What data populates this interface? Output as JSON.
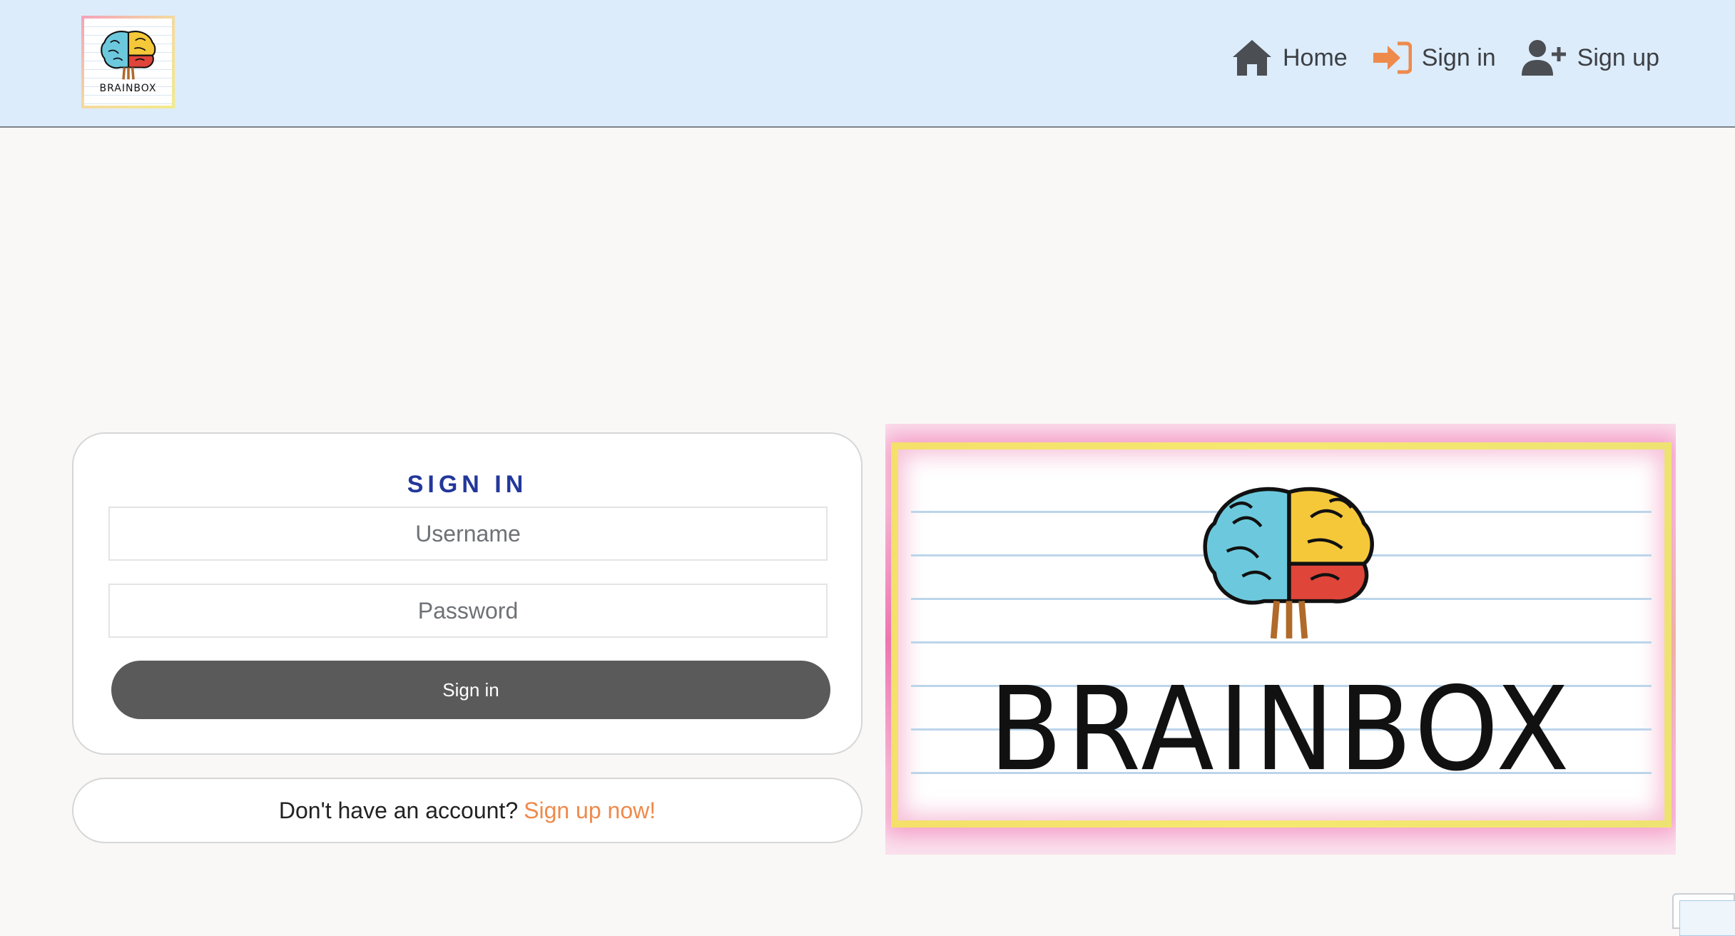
{
  "header": {
    "logo_text": "BRAINBOX",
    "nav": [
      {
        "label": "Home",
        "icon": "home-icon"
      },
      {
        "label": "Sign in",
        "icon": "sign-in-icon"
      },
      {
        "label": "Sign up",
        "icon": "user-plus-icon"
      }
    ]
  },
  "signin": {
    "title": "SIGN IN",
    "username_placeholder": "Username",
    "password_placeholder": "Password",
    "button_label": "Sign in"
  },
  "signup": {
    "prompt": "Don't have an account?",
    "link_label": "Sign up now!"
  },
  "hero": {
    "logo_text": "BRAINBOX"
  },
  "colors": {
    "header_bg": "#dcecfa",
    "page_bg": "#f9f8f6",
    "title_blue": "#23379a",
    "accent_orange": "#ee8a4c",
    "button_gray": "#5a5a5a",
    "brain_blue": "#6cc9dd",
    "brain_yellow": "#f5c83a",
    "brain_red": "#e0453a"
  }
}
